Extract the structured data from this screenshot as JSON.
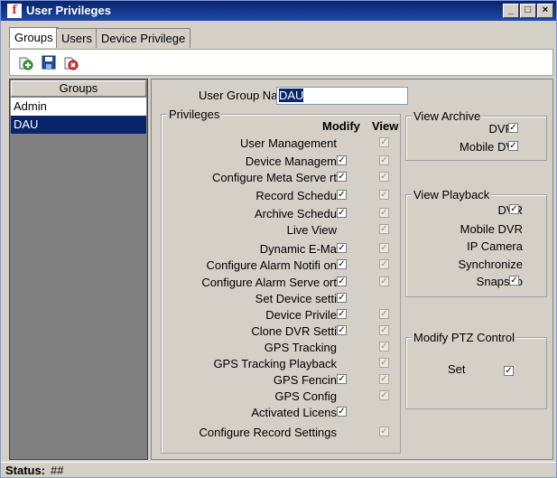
{
  "window": {
    "title": "User Privileges",
    "min": "_",
    "max": "□",
    "close": "×"
  },
  "tabs": [
    "Groups",
    "Users",
    "Device Privilege"
  ],
  "groups": {
    "header": "Groups",
    "items": [
      "Admin",
      "DAU"
    ]
  },
  "form": {
    "label": "User Group Na",
    "value": "DAU"
  },
  "privileges": {
    "title": "Privileges",
    "col_modify": "Modify",
    "col_view": "View",
    "items": [
      {
        "label": "User Management",
        "modify": null,
        "view": "✓"
      },
      {
        "label": "Device Managem",
        "modify": "✓",
        "view": "✓"
      },
      {
        "label": "Configure Meta Serve   rt",
        "modify": "✓",
        "view": "✓"
      },
      {
        "label": "Record Schedu",
        "modify": "✓",
        "view": "✓"
      },
      {
        "label": "Archive Schedu",
        "modify": "✓",
        "view": "✓"
      },
      {
        "label": "Live View",
        "modify": null,
        "view": "✓"
      },
      {
        "label": "Dynamic E-Ma",
        "modify": "✓",
        "view": "✓"
      },
      {
        "label": "Configure Alarm Notifi   on",
        "modify": "✓",
        "view": "✓"
      },
      {
        "label": "Configure Alarm Serve   ort",
        "modify": "✓",
        "view": "✓"
      },
      {
        "label": "Set Device setti",
        "modify": "✓",
        "view": null
      },
      {
        "label": "Device Privile",
        "modify": "✓",
        "view": "✓"
      },
      {
        "label": "Clone DVR Setti",
        "modify": "✓",
        "view": "✓"
      },
      {
        "label": "GPS Tracking",
        "modify": null,
        "view": "✓"
      },
      {
        "label": "GPS Tracking Playback",
        "modify": null,
        "view": "✓"
      },
      {
        "label": "GPS Fencin",
        "modify": "✓",
        "view": "✓"
      },
      {
        "label": "GPS Config",
        "modify": null,
        "view": "✓"
      },
      {
        "label": "Activated Licens",
        "modify": "✓",
        "view": null
      },
      {
        "label": "Configure Record Settings",
        "modify": null,
        "view": "✓"
      }
    ]
  },
  "view_archive": {
    "title": "View Archive",
    "items": [
      {
        "label": "DVR",
        "check": "✓"
      },
      {
        "label": "Mobile DV",
        "check": "✓"
      }
    ]
  },
  "view_playback": {
    "title": "View Playback",
    "items": [
      {
        "label": "DVR",
        "check": "✓"
      },
      {
        "label": "Mobile DVR",
        "check": null
      },
      {
        "label": "IP Camera",
        "check": null
      },
      {
        "label": "Synchronize",
        "check": null
      },
      {
        "label": "Snapsho",
        "check": "✓"
      }
    ]
  },
  "ptz": {
    "title": "Modify PTZ Control",
    "set_label": "Set",
    "check": "✓"
  },
  "status": {
    "label": "Status:",
    "value": "##"
  }
}
